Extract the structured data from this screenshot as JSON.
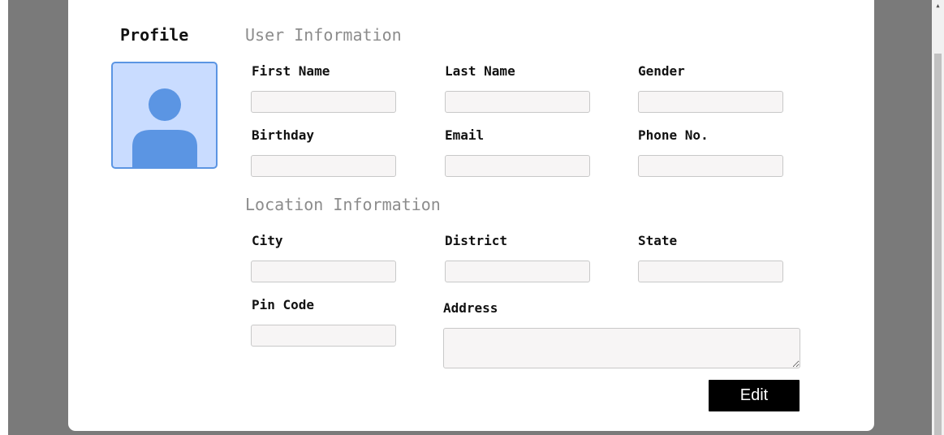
{
  "profile": {
    "title": "Profile",
    "avatar_icon": "user-avatar-icon"
  },
  "user_information": {
    "title": "User Information",
    "fields": {
      "first_name": {
        "label": "First Name",
        "value": "",
        "placeholder": ""
      },
      "last_name": {
        "label": "Last Name",
        "value": "",
        "placeholder": ""
      },
      "gender": {
        "label": "Gender",
        "value": "",
        "placeholder": ""
      },
      "birthday": {
        "label": "Birthday",
        "value": "",
        "placeholder": ""
      },
      "email": {
        "label": "Email",
        "value": "",
        "placeholder": ""
      },
      "phone": {
        "label": "Phone No.",
        "value": "",
        "placeholder": ""
      }
    }
  },
  "location_information": {
    "title": "Location Information",
    "fields": {
      "city": {
        "label": "City",
        "value": "",
        "placeholder": ""
      },
      "district": {
        "label": "District",
        "value": "",
        "placeholder": ""
      },
      "state": {
        "label": "State",
        "value": "",
        "placeholder": ""
      },
      "pin_code": {
        "label": "Pin Code",
        "value": "",
        "placeholder": ""
      },
      "address": {
        "label": "Address",
        "value": "",
        "placeholder": ""
      }
    }
  },
  "actions": {
    "edit_label": "Edit"
  },
  "colors": {
    "avatar_background": "#c9dcff",
    "avatar_figure": "#5b95e3",
    "button_background": "#000000",
    "page_backdrop": "#7a7a7a"
  }
}
